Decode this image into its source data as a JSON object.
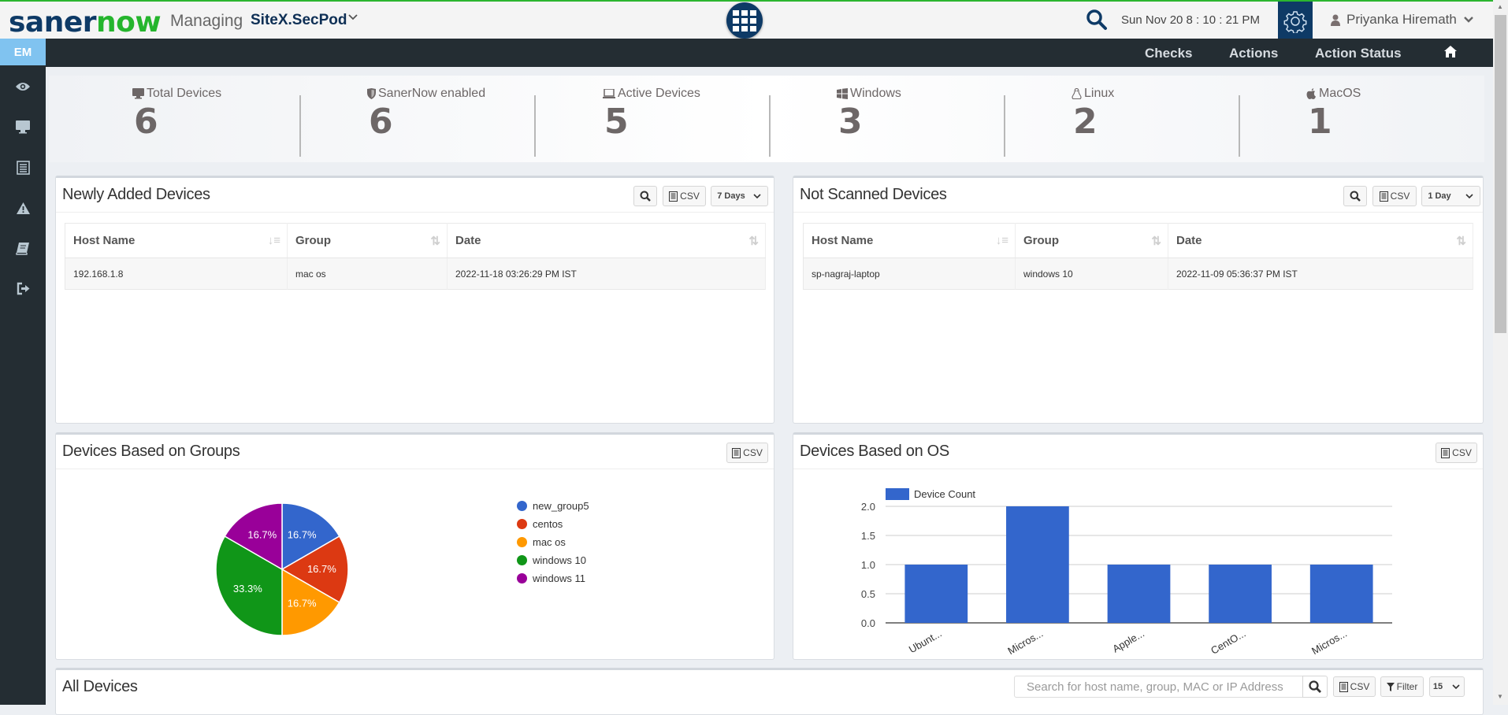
{
  "header": {
    "logo_part1": "saner",
    "logo_part2": "now",
    "managing_label": "Managing",
    "site_name": "SiteX.SecPod",
    "datetime": "Sun Nov 20  8 : 10 : 21 PM",
    "user_name": "Priyanka Hiremath",
    "icons": {
      "apps": "grid-icon",
      "search": "search-icon",
      "settings": "gear-icon",
      "user": "user-icon",
      "dropdown": "chevron-down-icon"
    }
  },
  "nav": {
    "module": "EM",
    "links": [
      "Checks",
      "Actions",
      "Action Status"
    ],
    "home_icon": "home-icon"
  },
  "sidebar": {
    "items": [
      {
        "icon": "eye-icon"
      },
      {
        "icon": "monitor-icon"
      },
      {
        "icon": "list-icon"
      },
      {
        "icon": "warning-icon"
      },
      {
        "icon": "book-icon"
      },
      {
        "icon": "logout-icon"
      }
    ]
  },
  "stats": [
    {
      "label": "Total Devices",
      "value": "6",
      "icon": "desktop-icon"
    },
    {
      "label": "SanerNow enabled",
      "value": "6",
      "icon": "shield-icon"
    },
    {
      "label": "Active Devices",
      "value": "5",
      "icon": "laptop-icon"
    },
    {
      "label": "Windows",
      "value": "3",
      "icon": "windows-icon"
    },
    {
      "label": "Linux",
      "value": "2",
      "icon": "linux-icon"
    },
    {
      "label": "MacOS",
      "value": "1",
      "icon": "apple-icon"
    }
  ],
  "newly_added": {
    "title": "Newly Added Devices",
    "csv_label": "CSV",
    "range": "7 Days",
    "columns": [
      "Host Name",
      "Group",
      "Date"
    ],
    "rows": [
      {
        "host": "192.168.1.8",
        "group": "mac os",
        "date": "2022-11-18 03:26:29 PM IST"
      }
    ]
  },
  "not_scanned": {
    "title": "Not Scanned Devices",
    "csv_label": "CSV",
    "range": "1 Day",
    "columns": [
      "Host Name",
      "Group",
      "Date"
    ],
    "rows": [
      {
        "host": "sp-nagraj-laptop",
        "group": "windows 10",
        "date": "2022-11-09 05:36:37 PM IST"
      }
    ]
  },
  "groups_panel": {
    "title": "Devices Based on Groups",
    "csv_label": "CSV"
  },
  "os_panel": {
    "title": "Devices Based on OS",
    "csv_label": "CSV"
  },
  "all_devices": {
    "title": "All Devices",
    "search_placeholder": "Search for host name, group, MAC or IP Address",
    "csv_label": "CSV",
    "filter_label": "Filter",
    "page_size": "15"
  },
  "chart_data": [
    {
      "type": "pie",
      "title": "Devices Based on Groups",
      "categories": [
        "new_group5",
        "centos",
        "mac os",
        "windows 10",
        "windows 11"
      ],
      "values": [
        1,
        1,
        1,
        2,
        1
      ],
      "labels": [
        "16.7%",
        "16.7%",
        "16.7%",
        "33.3%",
        "16.7%"
      ],
      "colors": [
        "#3366cc",
        "#dc3912",
        "#ff9900",
        "#109618",
        "#990099"
      ],
      "legend": "right"
    },
    {
      "type": "bar",
      "title": "Devices Based on OS",
      "categories": [
        "Ubunt...",
        "Micros...",
        "Apple...",
        "CentO...",
        "Micros..."
      ],
      "series": [
        {
          "name": "Device Count",
          "values": [
            1,
            2,
            1,
            1,
            1
          ],
          "color": "#3366cc"
        }
      ],
      "yticks": [
        "0.0",
        "0.5",
        "1.0",
        "1.5",
        "2.0"
      ],
      "ylim": [
        0,
        2
      ],
      "legend": "top-left",
      "grid": true
    }
  ]
}
